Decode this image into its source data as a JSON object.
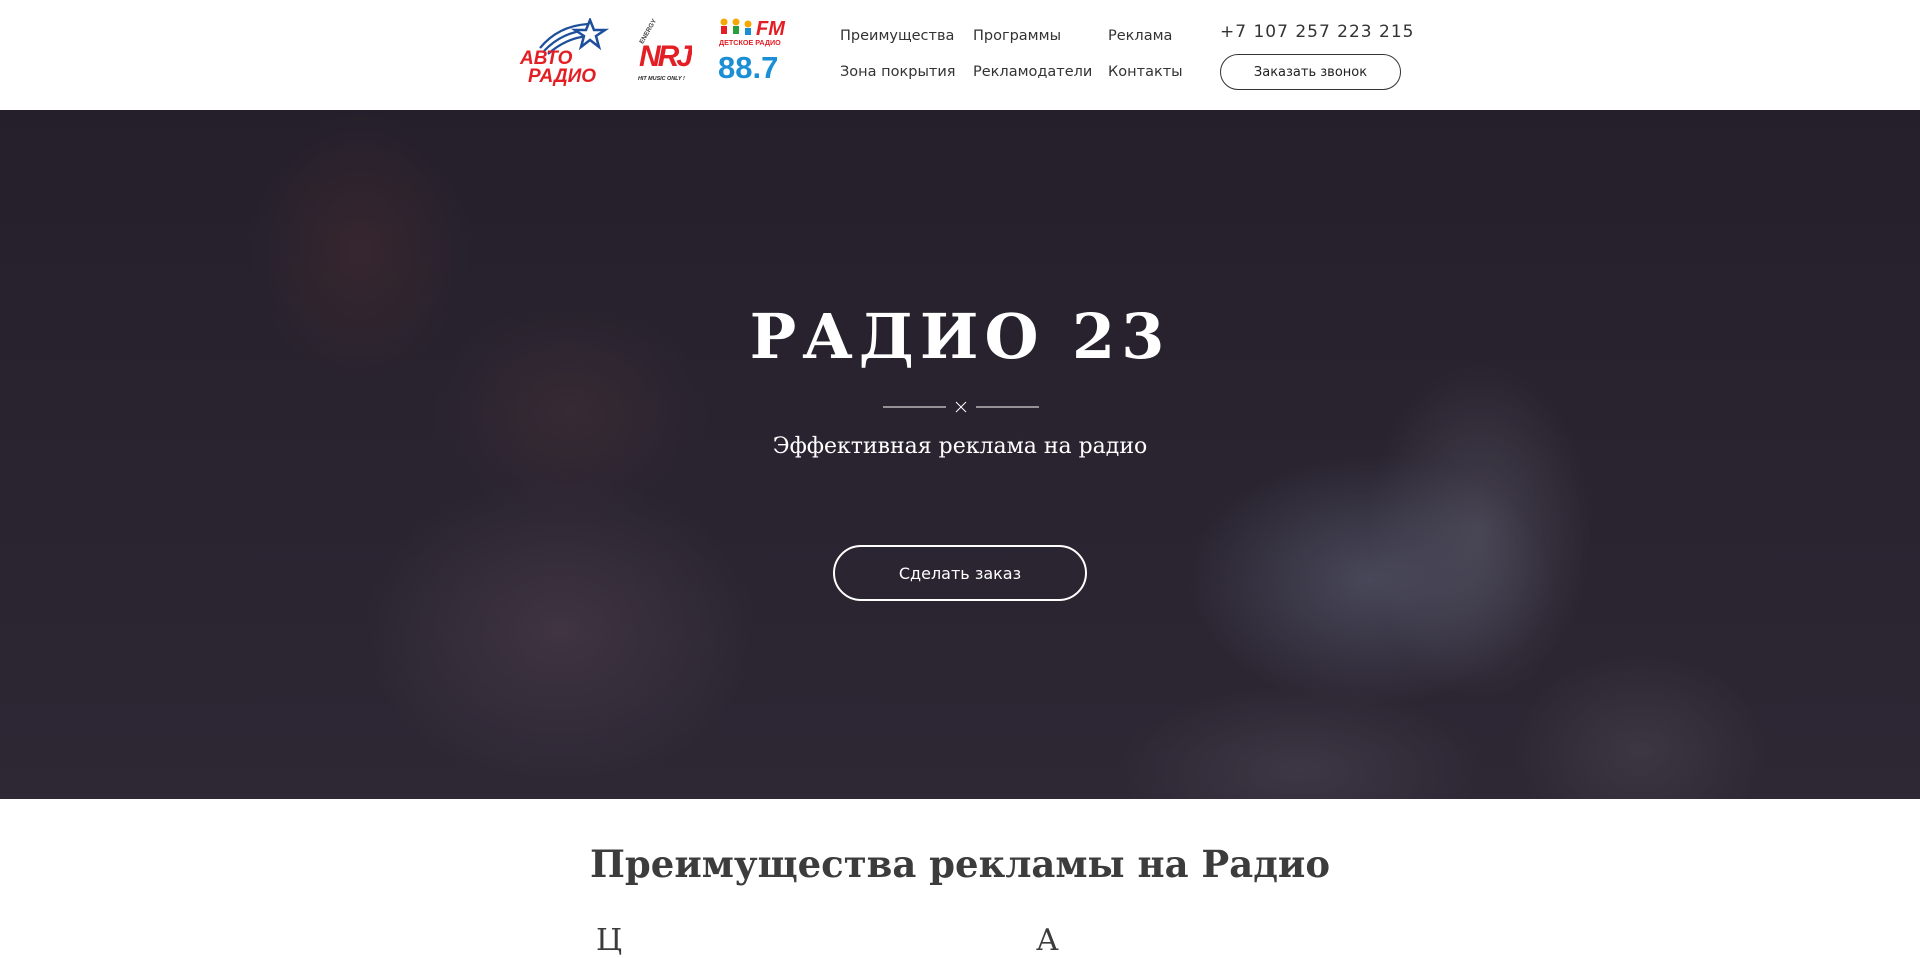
{
  "header": {
    "logos": [
      {
        "name": "avtoradio",
        "line1": "АВТО",
        "line2": "РАДИО",
        "color": "#e31e24",
        "accent": "#1d4f9c"
      },
      {
        "name": "energy",
        "mark": "NRJ",
        "top": "ENERGY",
        "tagline": "HIT MUSIC ONLY !",
        "color": "#e31e24"
      },
      {
        "name": "detskoe-radio",
        "mark": "FM",
        "caption": "ДЕТСКОЕ РАДИО",
        "frequency": "88.7",
        "color": "#1a8fd6",
        "accent": "#e31e24"
      }
    ],
    "nav": [
      {
        "label": "Преимущества"
      },
      {
        "label": "Программы"
      },
      {
        "label": "Реклама"
      },
      {
        "label": "Зона покрытия"
      },
      {
        "label": "Рекламодатели"
      },
      {
        "label": "Контакты"
      }
    ],
    "phone": "+7 107 257 223 215",
    "callback_label": "Заказать звонок"
  },
  "hero": {
    "title": "РАДИО 23",
    "subtitle": "Эффективная реклама на радио",
    "button_label": "Сделать заказ"
  },
  "advantages": {
    "title": "Преимущества рекламы на Радио",
    "cut_text_1": "Ц",
    "cut_text_2": "А"
  },
  "colors": {
    "text": "#333333",
    "hero_overlay": "#1e1a26",
    "white": "#ffffff"
  }
}
